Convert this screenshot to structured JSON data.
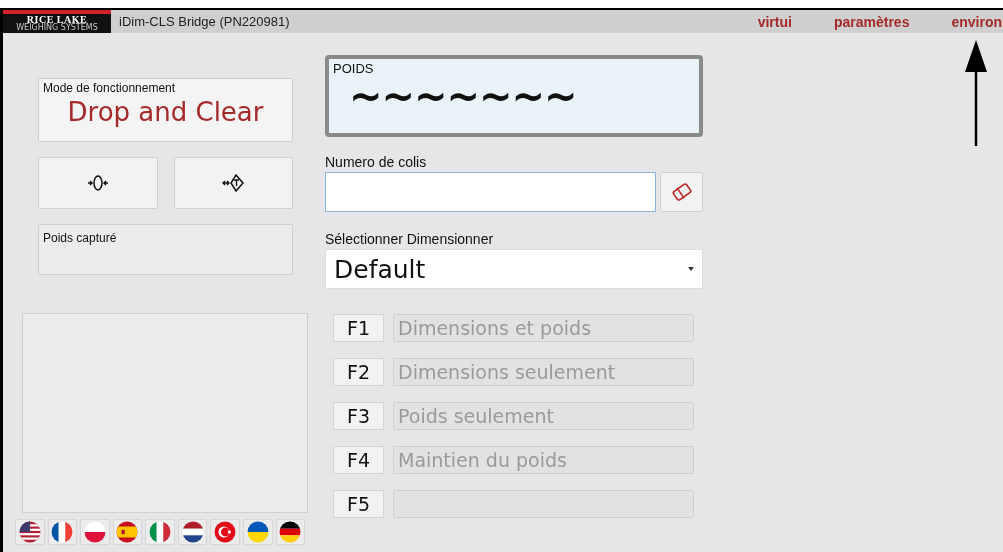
{
  "header": {
    "logo": {
      "name": "RICE LAKE",
      "tagline": "WEIGHING SYSTEMS"
    },
    "title": "iDim-CLS Bridge (PN220981)",
    "menu": [
      "virtui",
      "paramètres",
      "environ"
    ]
  },
  "mode": {
    "label": "Mode de fonctionnement",
    "value": "Drop and Clear"
  },
  "captured_weight": {
    "label": "Poids capturé"
  },
  "weight": {
    "label": "POIDS",
    "value": "~~~~~~~"
  },
  "parcel": {
    "label": "Numero de colis"
  },
  "dimensioner": {
    "label": "Sélectionner Dimensionner",
    "value": "Default"
  },
  "functions": [
    {
      "key": "F1",
      "label": "Dimensions et poids",
      "disabled": true
    },
    {
      "key": "F2",
      "label": "Dimensions seulement",
      "disabled": true
    },
    {
      "key": "F3",
      "label": "Poids seulement",
      "disabled": true
    },
    {
      "key": "F4",
      "label": "Maintien du poids",
      "disabled": true
    },
    {
      "key": "F5",
      "disabled": true
    }
  ]
}
